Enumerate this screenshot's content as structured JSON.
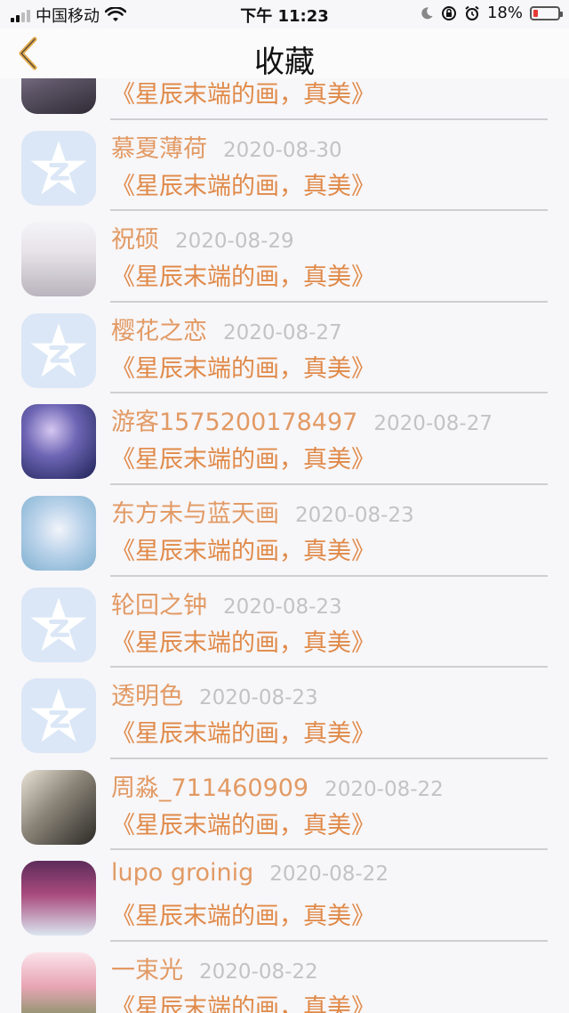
{
  "status_bar": {
    "carrier": "中国移动",
    "time": "下午 11:23",
    "battery": "18%",
    "battery_level": 0.18,
    "icons": [
      "signal-icon",
      "wifi-icon",
      "moon-icon",
      "lock-rotation-icon",
      "alarm-icon",
      "battery-icon"
    ]
  },
  "nav": {
    "title": "收藏",
    "back_icon": "chevron-left-icon",
    "accent_color": "#e2a94a"
  },
  "colors": {
    "name": "#e29a64",
    "comment": "#e08a49",
    "date": "#c3c3c3",
    "qq_avatar_bg": "#dbe7f6"
  },
  "items": [
    {
      "name": "",
      "date": "",
      "comment": "《星辰末端的画，真美》",
      "avatar": "photo-avatar"
    },
    {
      "name": "慕夏薄荷",
      "date": "2020-08-30",
      "comment": "《星辰末端的画，真美》",
      "avatar": "qq-star-avatar"
    },
    {
      "name": "祝硕",
      "date": "2020-08-29",
      "comment": "《星辰末端的画，真美》",
      "avatar": "photo-avatar"
    },
    {
      "name": "樱花之恋",
      "date": "2020-08-27",
      "comment": "《星辰末端的画，真美》",
      "avatar": "qq-star-avatar"
    },
    {
      "name": "游客1575200178497",
      "date": "2020-08-27",
      "comment": "《星辰末端的画，真美》",
      "avatar": "photo-avatar"
    },
    {
      "name": "东方未与蓝天画",
      "date": "2020-08-23",
      "comment": "《星辰末端的画，真美》",
      "avatar": "photo-avatar"
    },
    {
      "name": "轮回之钟",
      "date": "2020-08-23",
      "comment": "《星辰末端的画，真美》",
      "avatar": "qq-star-avatar"
    },
    {
      "name": "透明色",
      "date": "2020-08-23",
      "comment": "《星辰末端的画，真美》",
      "avatar": "qq-star-avatar"
    },
    {
      "name": "周淼_711460909",
      "date": "2020-08-22",
      "comment": "《星辰末端的画，真美》",
      "avatar": "photo-avatar"
    },
    {
      "name": "lupo groinig",
      "date": "2020-08-22",
      "comment": "《星辰末端的画，真美》",
      "avatar": "photo-avatar"
    },
    {
      "name": "一束光",
      "date": "2020-08-22",
      "comment": "《星辰末端的画，真美》",
      "avatar": "photo-avatar"
    }
  ]
}
